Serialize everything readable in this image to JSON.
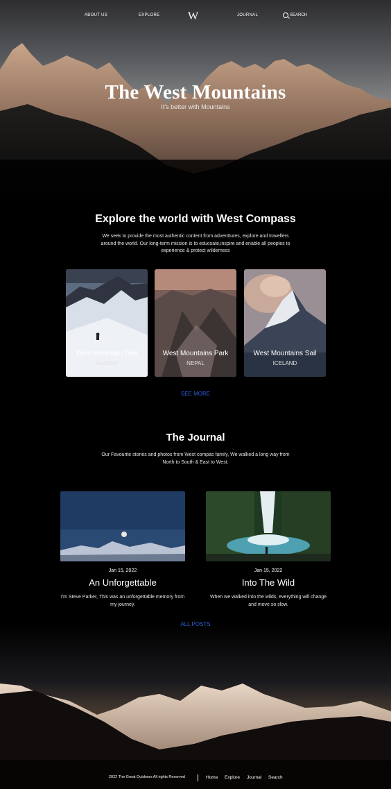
{
  "nav": {
    "about": "ABOUT US",
    "explore": "EXPLORE",
    "logo": "W",
    "journal": "JOURNAL",
    "search": "SEARCH"
  },
  "hero": {
    "title": "The West Mountains",
    "subtitle": "It's better with Mountains"
  },
  "explore": {
    "title": "Explore the world with West Compass",
    "description": "We seek to provide the most authentic content from  adventtures, explore and travellers around the world. Our long-term mission is to educoate,inspire and enable all peoples to experience & protect wilderness",
    "cards": [
      {
        "name": "West Mountain Trek",
        "location": "ALASKA"
      },
      {
        "name": "West Mountains Park",
        "location": "NEPAL"
      },
      {
        "name": "West Mountains Sail",
        "location": "ICELAND"
      }
    ],
    "see_more": "SEE MORE"
  },
  "journal": {
    "title": "The Journal",
    "description": "Our Favourite stories and photos from West compas family, We walked a long way from North to South & East to West.",
    "posts": [
      {
        "date": "Jan 15, 2022",
        "title": "An Unforgettable",
        "excerpt": "I'm Steve Parker, This was an unforgettable memory from my journey."
      },
      {
        "date": "Jan 15, 2022",
        "title": "Into The Wild",
        "excerpt": "When we walked into the wilds, everything will change and move so slow."
      }
    ],
    "all_posts": "ALL POSTS"
  },
  "footer": {
    "copyright": "2022 The Great Outdoors All rights Reserved",
    "links": [
      "Home",
      "Explore",
      "Journal",
      "Search"
    ]
  },
  "colors": {
    "accent_link": "#2f5ed8",
    "background": "#000000"
  }
}
